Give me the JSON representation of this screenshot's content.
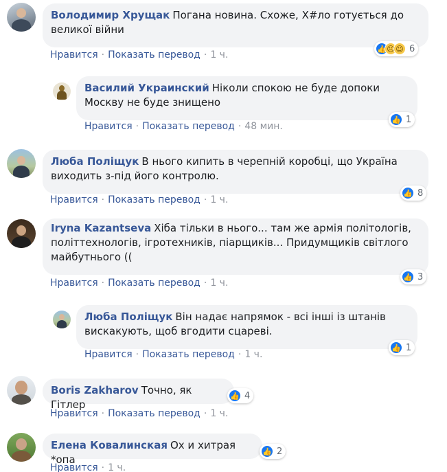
{
  "actions": {
    "like": "Нравится",
    "translate": "Показать перевод",
    "separator": "·"
  },
  "comments": [
    {
      "author": "Володимир Хрущак",
      "text_line1": "Погана новина. Схоже, Х#ло готується до",
      "text_line2": "великої війни",
      "time": "1 ч.",
      "reactions": "6",
      "reaction_icons": [
        "like-icon",
        "sad-icon",
        "haha-icon"
      ]
    },
    {
      "author": "Василий Украинский",
      "text_line1": "Ніколи спокою не буде допоки",
      "text_line2": "Москву не буде знищено",
      "time": "48 мин.",
      "reactions": "1"
    },
    {
      "author": "Люба Поліщук",
      "text_line1": "В нього кипить в черепній коробці, що Україна",
      "text_line2": "виходить з-під його контролю.",
      "time": "1 ч.",
      "reactions": "8"
    },
    {
      "author": "Iryna Kazantseva",
      "text_line1": "Хіба тільки в нього... там же армія політологів,",
      "text_line2": "політтехнологів, ігротехників, піарщиків... Придумщиків світлого",
      "text_line3": "майбутнього ((",
      "time": "1 ч.",
      "reactions": "3"
    },
    {
      "author": "Люба Поліщук",
      "text_line1": "Він надає напрямок - всі інші із штанів",
      "text_line2": "вискакують, щоб вгодити сцареві.",
      "time": "1 ч.",
      "reactions": "1"
    },
    {
      "author": "Boris Zakharov",
      "text_line1": "Точно, як Гітлер",
      "time": "1 ч.",
      "reactions": "4"
    },
    {
      "author": "Елена Ковалинская",
      "text_line1": "Ох и хитрая *опа",
      "time": "1 ч.",
      "reactions": "2"
    }
  ],
  "colors": {
    "author": "#385898",
    "bubble": "#f2f3f5",
    "like": "#1877f2"
  }
}
